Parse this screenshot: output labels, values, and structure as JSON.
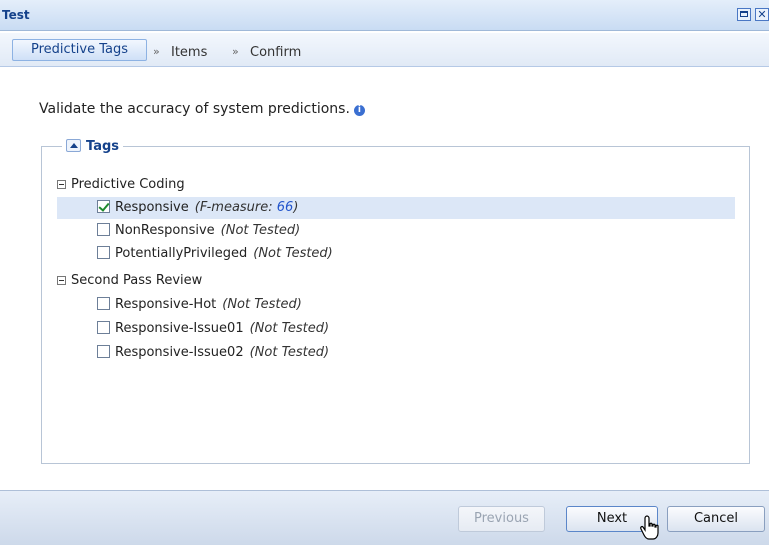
{
  "window": {
    "title": "Test",
    "close_glyph": "✕"
  },
  "breadcrumb": {
    "steps": [
      "Predictive Tags",
      "Items",
      "Confirm"
    ],
    "separator": "»"
  },
  "instruction": {
    "text": "Validate the accuracy of system predictions.",
    "info_glyph": "i"
  },
  "tags_panel": {
    "legend": "Tags",
    "groups": [
      {
        "label": "Predictive Coding",
        "items": [
          {
            "label": "Responsive",
            "status_prefix": "(F-measure: ",
            "status_value": "66",
            "status_suffix": ")",
            "checked": true
          },
          {
            "label": "NonResponsive",
            "status": "(Not Tested)",
            "checked": false
          },
          {
            "label": "PotentiallyPrivileged",
            "status": "(Not Tested)",
            "checked": false
          }
        ]
      },
      {
        "label": "Second Pass Review",
        "items": [
          {
            "label": "Responsive-Hot",
            "status": "(Not Tested)",
            "checked": false
          },
          {
            "label": "Responsive-Issue01",
            "status": "(Not Tested)",
            "checked": false
          },
          {
            "label": "Responsive-Issue02",
            "status": "(Not Tested)",
            "checked": false
          }
        ]
      }
    ]
  },
  "footer": {
    "previous_label": "Previous",
    "next_label": "Next",
    "cancel_label": "Cancel"
  },
  "colors": {
    "accent": "#15428b",
    "selected_row": "#dce7f7",
    "link_value": "#2255cc"
  },
  "icons": {
    "info": "info-icon",
    "collapse": "chevron-up-icon",
    "cursor": "hand-cursor-icon"
  }
}
